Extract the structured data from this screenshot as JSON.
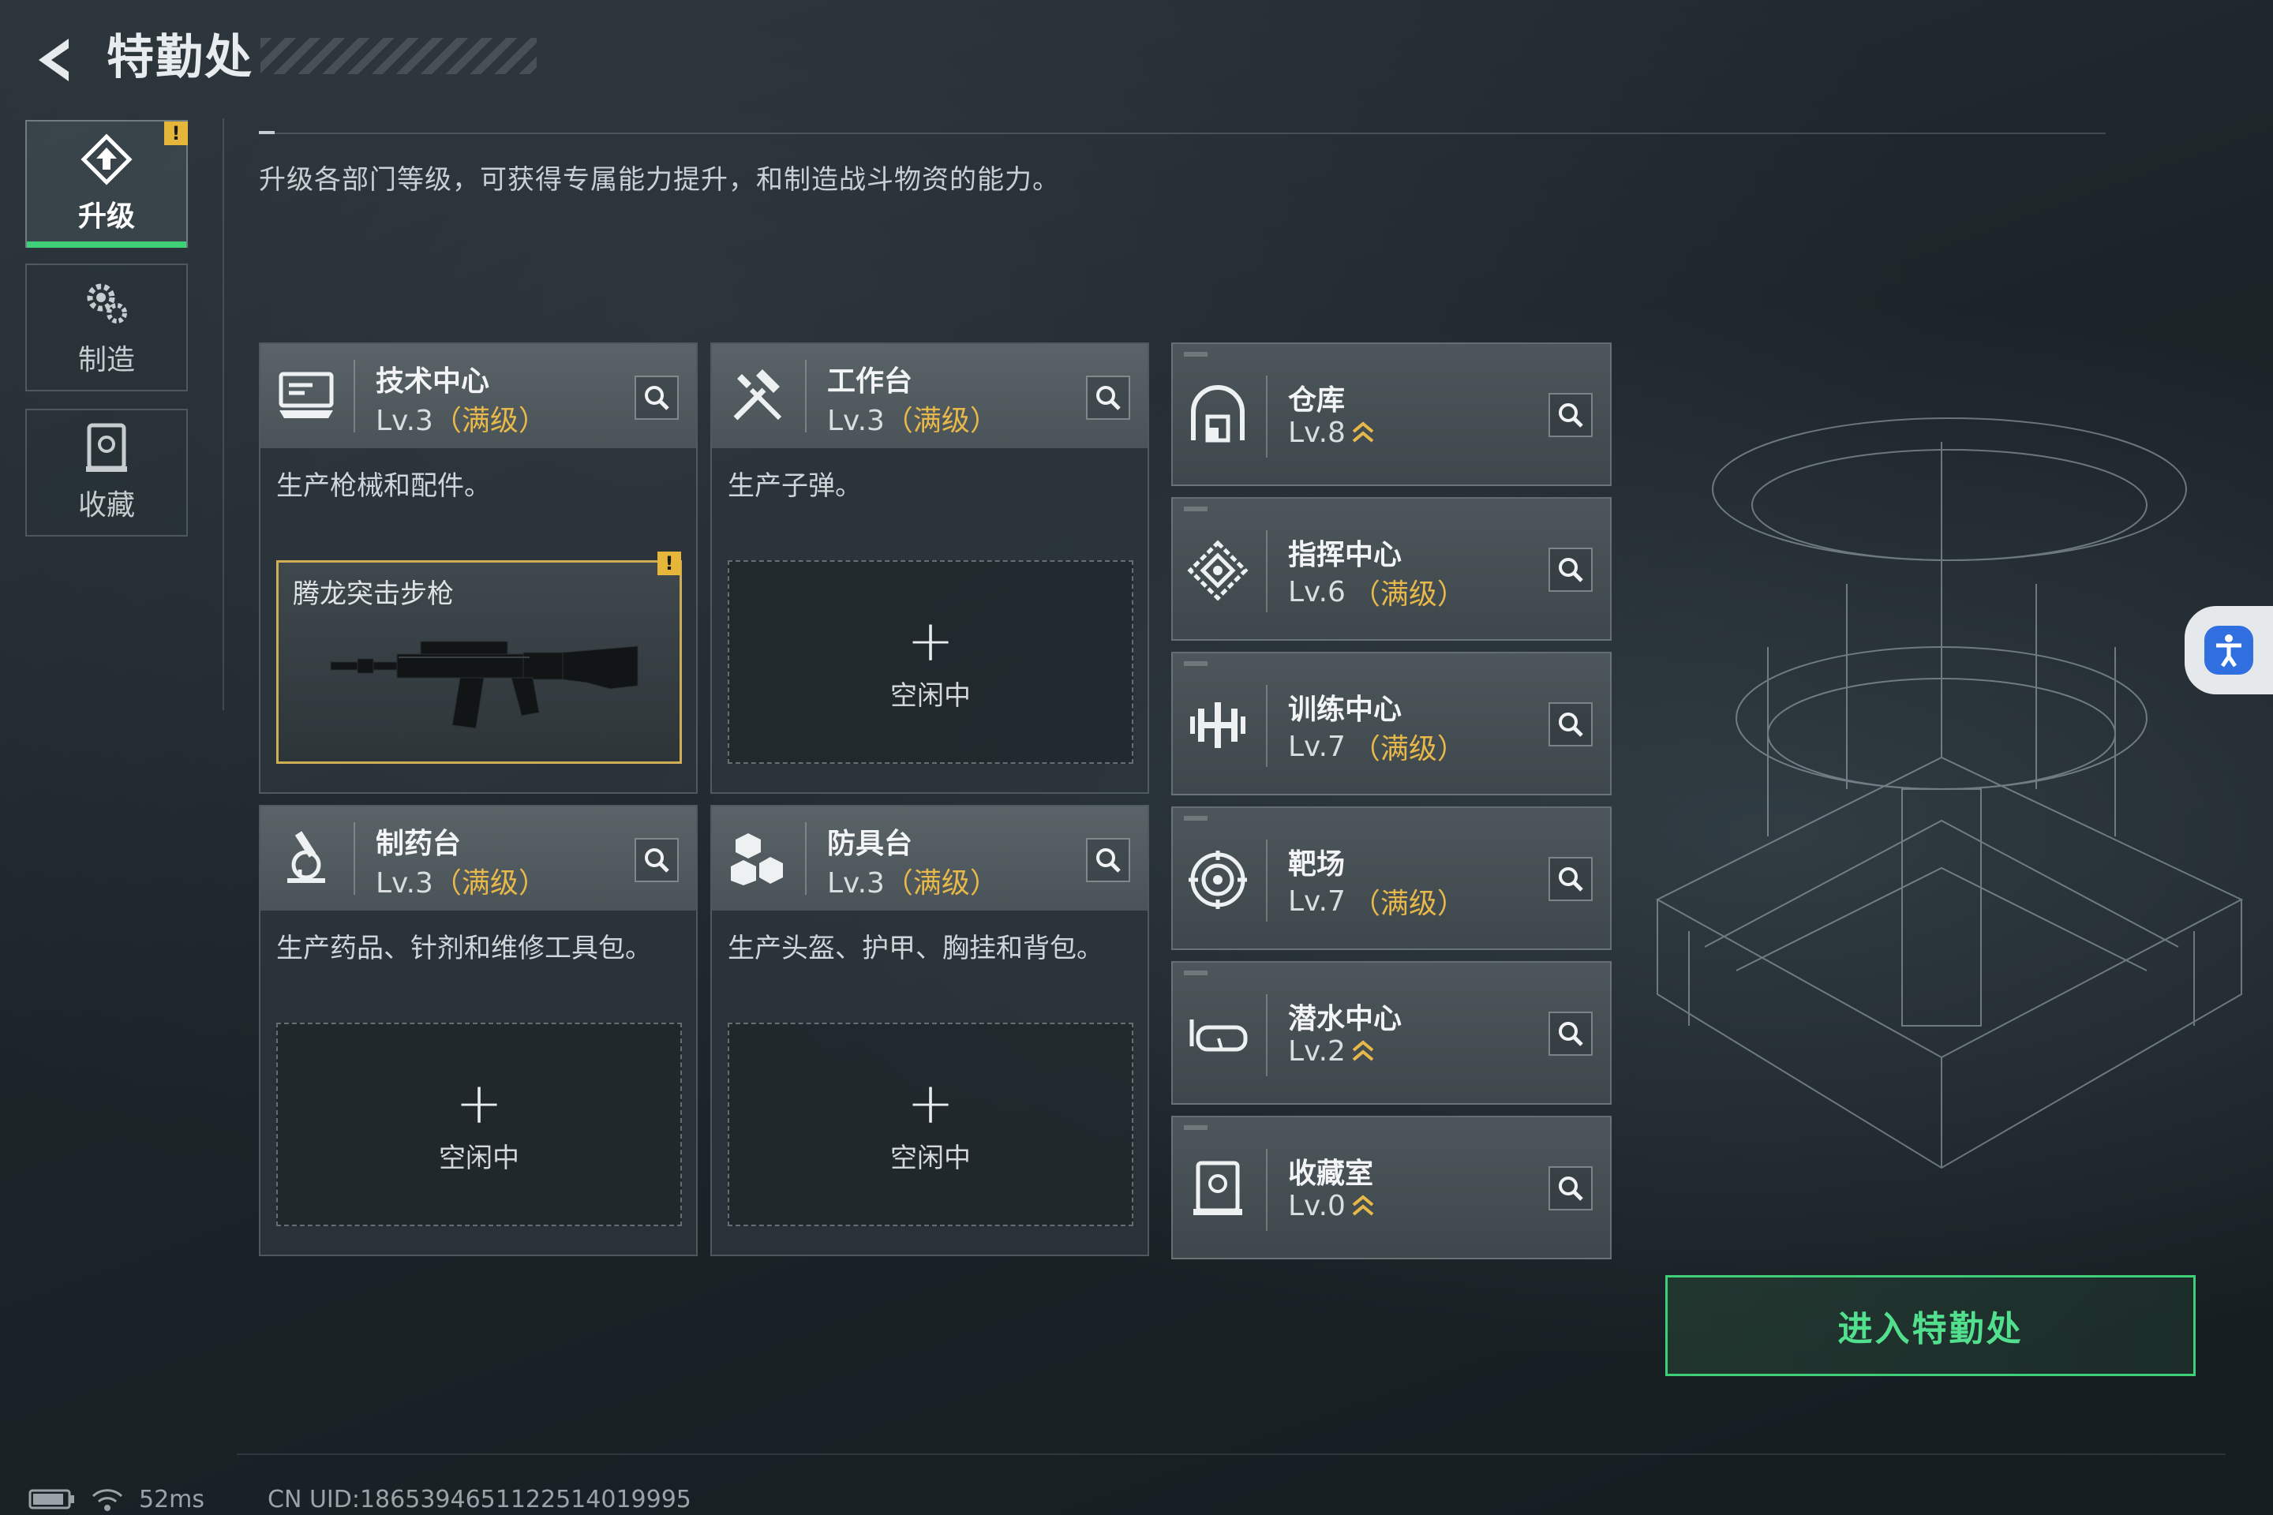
{
  "header": {
    "title": "特勤处"
  },
  "sidebar": {
    "tabs": [
      {
        "label": "升级",
        "icon": "upgrade-icon",
        "active": true,
        "alert": "!"
      },
      {
        "label": "制造",
        "icon": "gear-icon",
        "active": false
      },
      {
        "label": "收藏",
        "icon": "collection-icon",
        "active": false
      }
    ]
  },
  "description": "升级各部门等级，可获得专属能力提升，和制造战斗物资的能力。",
  "production": [
    {
      "name": "技术中心",
      "level": "Lv.3",
      "max_tag": "（满级）",
      "desc": "生产枪械和配件。",
      "icon": "monitor-icon",
      "slot": {
        "state": "producing",
        "item": "腾龙突击步枪",
        "alert": "!"
      }
    },
    {
      "name": "工作台",
      "level": "Lv.3",
      "max_tag": "（满级）",
      "desc": "生产子弹。",
      "icon": "tools-icon",
      "slot": {
        "state": "idle",
        "plus": "+",
        "idle_label": "空闲中"
      }
    },
    {
      "name": "制药台",
      "level": "Lv.3",
      "max_tag": "（满级）",
      "desc": "生产药品、针剂和维修工具包。",
      "icon": "microscope-icon",
      "slot": {
        "state": "idle",
        "plus": "+",
        "idle_label": "空闲中"
      }
    },
    {
      "name": "防具台",
      "level": "Lv.3",
      "max_tag": "（满级）",
      "desc": "生产头盔、护甲、胸挂和背包。",
      "icon": "armor-icon",
      "slot": {
        "state": "idle",
        "plus": "+",
        "idle_label": "空闲中"
      }
    }
  ],
  "facilities": [
    {
      "name": "仓库",
      "level": "Lv.8",
      "max_tag": "",
      "upgradable": true,
      "icon": "warehouse-icon"
    },
    {
      "name": "指挥中心",
      "level": "Lv.6",
      "max_tag": "（满级）",
      "upgradable": false,
      "icon": "command-icon"
    },
    {
      "name": "训练中心",
      "level": "Lv.7",
      "max_tag": "（满级）",
      "upgradable": false,
      "icon": "dumbbell-icon"
    },
    {
      "name": "靶场",
      "level": "Lv.7",
      "max_tag": "（满级）",
      "upgradable": false,
      "icon": "target-icon"
    },
    {
      "name": "潜水中心",
      "level": "Lv.2",
      "max_tag": "",
      "upgradable": true,
      "icon": "diving-mask-icon"
    },
    {
      "name": "收藏室",
      "level": "Lv.0",
      "max_tag": "",
      "upgradable": true,
      "icon": "display-case-icon"
    }
  ],
  "enter_button": "进入特勤处",
  "footer": {
    "ping": "52ms",
    "uid": "CN UID:1865394651122514019995"
  },
  "colors": {
    "accent_green": "#3fcf78",
    "max_level_gold": "#e7b84a",
    "alert_yellow": "#e5b63a",
    "a11y_blue": "#2f6fe0"
  }
}
